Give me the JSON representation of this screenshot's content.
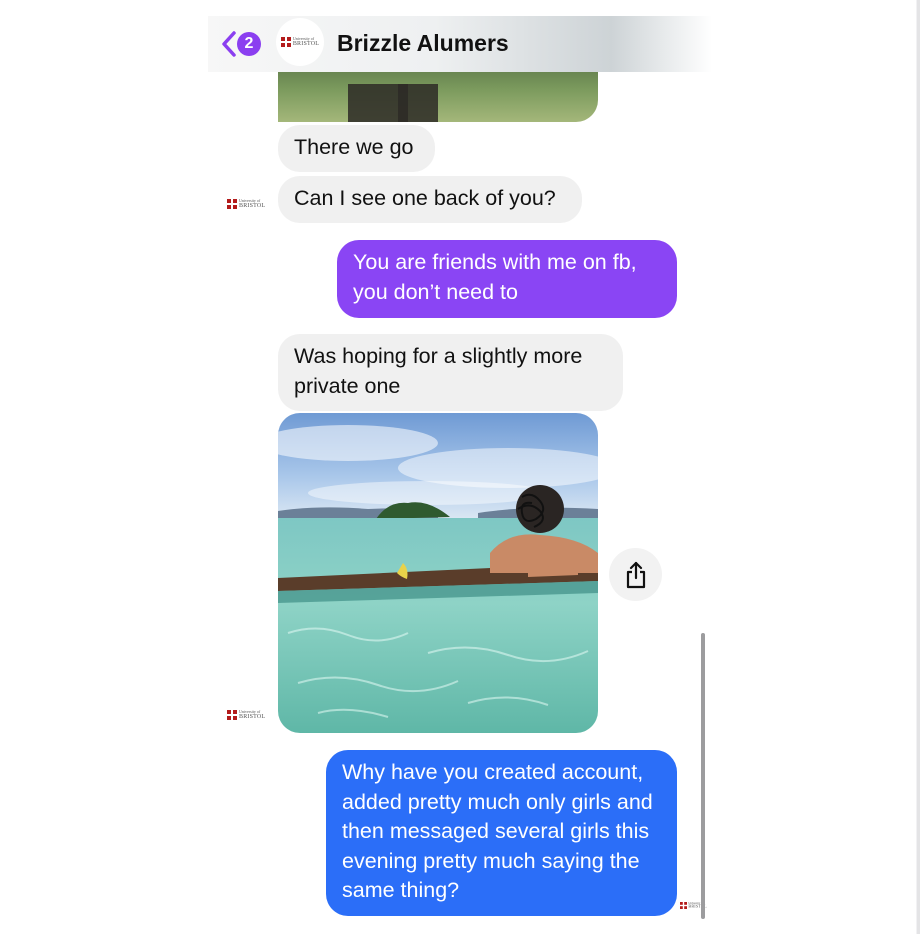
{
  "header": {
    "back_badge_count": "2",
    "avatar_logo": {
      "line1": "University of",
      "line2": "BRISTOL"
    },
    "title": "Brizzle Alumers"
  },
  "sender_logo": {
    "line1": "University of",
    "line2": "BRISTOL"
  },
  "messages": [
    {
      "direction": "incoming",
      "text": "There we go"
    },
    {
      "direction": "incoming",
      "text": "Can I see one back of you?"
    },
    {
      "direction": "outgoing",
      "text": "You are friends with me on fb, you don’t need to"
    },
    {
      "direction": "incoming",
      "text": "Was hoping for a slightly more private one"
    },
    {
      "direction": "outgoing",
      "text": "Why have you created account, added pretty much only girls and then messaged several girls this evening pretty much saying the same thing?"
    }
  ],
  "colors": {
    "accent_purple": "#8a45f4",
    "accent_blue": "#2b6ef8",
    "incoming_bubble": "#f0f0f0",
    "badge": "#8b3ff0"
  },
  "icons": {
    "back": "chevron-left-icon",
    "share": "share-icon"
  }
}
